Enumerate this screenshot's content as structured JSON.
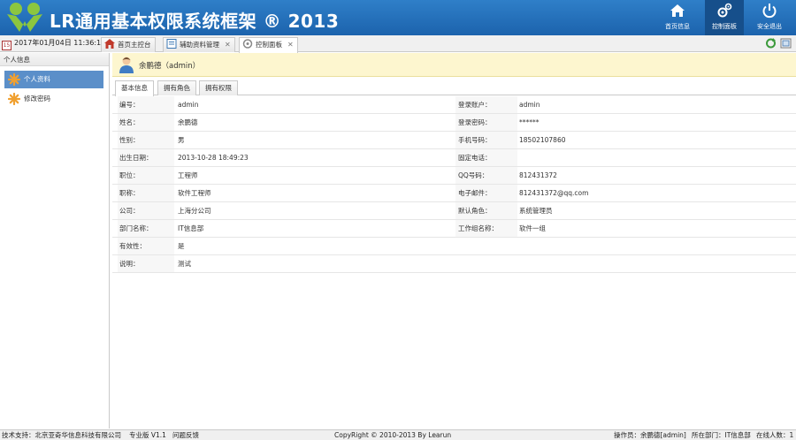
{
  "header": {
    "title": "LR通用基本权限系统框架 ® 2013",
    "buttons": [
      {
        "label": "首页信息",
        "icon": "home-icon"
      },
      {
        "label": "控制面板",
        "icon": "gears-icon"
      },
      {
        "label": "安全退出",
        "icon": "power-icon"
      }
    ]
  },
  "tabbar": {
    "datetime": "2017年01月04日 11:36:12",
    "tabs": [
      {
        "label": "首页主控台",
        "closable": false
      },
      {
        "label": "辅助资料管理",
        "closable": true
      },
      {
        "label": "控制面板",
        "closable": true
      }
    ]
  },
  "left": {
    "title": "个人信息",
    "items": [
      {
        "label": "个人资料",
        "active": true
      },
      {
        "label": "修改密码",
        "active": false
      }
    ]
  },
  "main": {
    "user_display": "余鹏德（admin）",
    "subtabs": [
      "基本信息",
      "拥有角色",
      "拥有权限"
    ],
    "rows": [
      {
        "l1": "编号：",
        "v1": "admin",
        "l2": "登录账户：",
        "v2": "admin"
      },
      {
        "l1": "姓名：",
        "v1": "余鹏德",
        "l2": "登录密码：",
        "v2": "******"
      },
      {
        "l1": "性别：",
        "v1": "男",
        "l2": "手机号码：",
        "v2": "18502107860"
      },
      {
        "l1": "出生日期：",
        "v1": "2013-10-28 18:49:23",
        "l2": "固定电话：",
        "v2": ""
      },
      {
        "l1": "职位：",
        "v1": "工程师",
        "l2": "QQ号码：",
        "v2": "812431372"
      },
      {
        "l1": "职称：",
        "v1": "软件工程师",
        "l2": "电子邮件：",
        "v2": "812431372@qq.com"
      },
      {
        "l1": "公司：",
        "v1": "上海分公司",
        "l2": "默认角色：",
        "v2": "系统管理员"
      },
      {
        "l1": "部门名称：",
        "v1": "IT信息部",
        "l2": "工作组名称：",
        "v2": "软件一组"
      },
      {
        "l1": "有效性：",
        "v1": "是"
      },
      {
        "l1": "说明：",
        "v1": "测试"
      }
    ]
  },
  "footer": {
    "support": "技术支持：北京亚奇华信息科技有限公司",
    "edition": "专业版 V1.1",
    "feedback": "问题反馈",
    "copyright": "CopyRight © 2010-2013 By Learun",
    "operator": "操作员：余鹏德[admin]",
    "department": "所在部门：IT信息部",
    "online": "在线人数：1"
  },
  "colors": {
    "header": "#2070b8",
    "accent": "#5b8fc9",
    "userbar": "#fdf6cf"
  }
}
